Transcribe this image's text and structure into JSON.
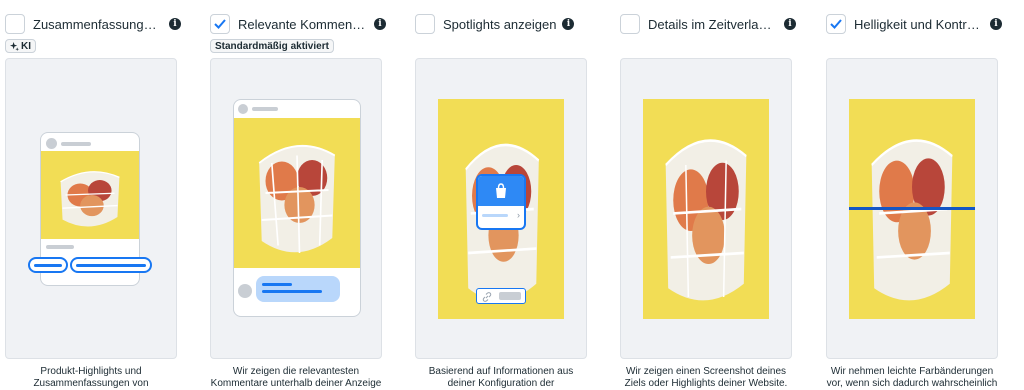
{
  "options": [
    {
      "label": "Zusammenfassungen anz...",
      "checked": false,
      "badge": "KI",
      "badge_icon": "sparkle-icon",
      "description": "Produkt-Highlights und Zusammenfassungen von"
    },
    {
      "label": "Relevante Kommentare",
      "checked": true,
      "badge": "Standardmäßig aktiviert",
      "description": "Wir zeigen die relevantesten Kommentare unterhalb deiner Anzeige auf Facebook"
    },
    {
      "label": "Spotlights anzeigen",
      "checked": false,
      "description": "Basierend auf Informationen aus deiner Konfiguration der Anzeigengestaltung..."
    },
    {
      "label": "Details im Zeitverlauf enth...",
      "checked": false,
      "description": "Wir zeigen einen Screenshot deines Ziels oder Highlights deiner Website."
    },
    {
      "label": "Helligkeit und Kontrast an...",
      "checked": true,
      "description": "Wir nehmen leichte Farbänderungen vor, wenn sich dadurch wahrscheinlich die..."
    }
  ],
  "colors": {
    "accent": "#1877f2",
    "photo_bg": "#f2dd55",
    "panel_bg": "#f0f2f5",
    "text": "#1c2b33"
  },
  "icons": {
    "info": "info-icon",
    "check": "checkmark-icon",
    "shopping_bag": "shopping-bag-icon",
    "link": "link-icon"
  }
}
